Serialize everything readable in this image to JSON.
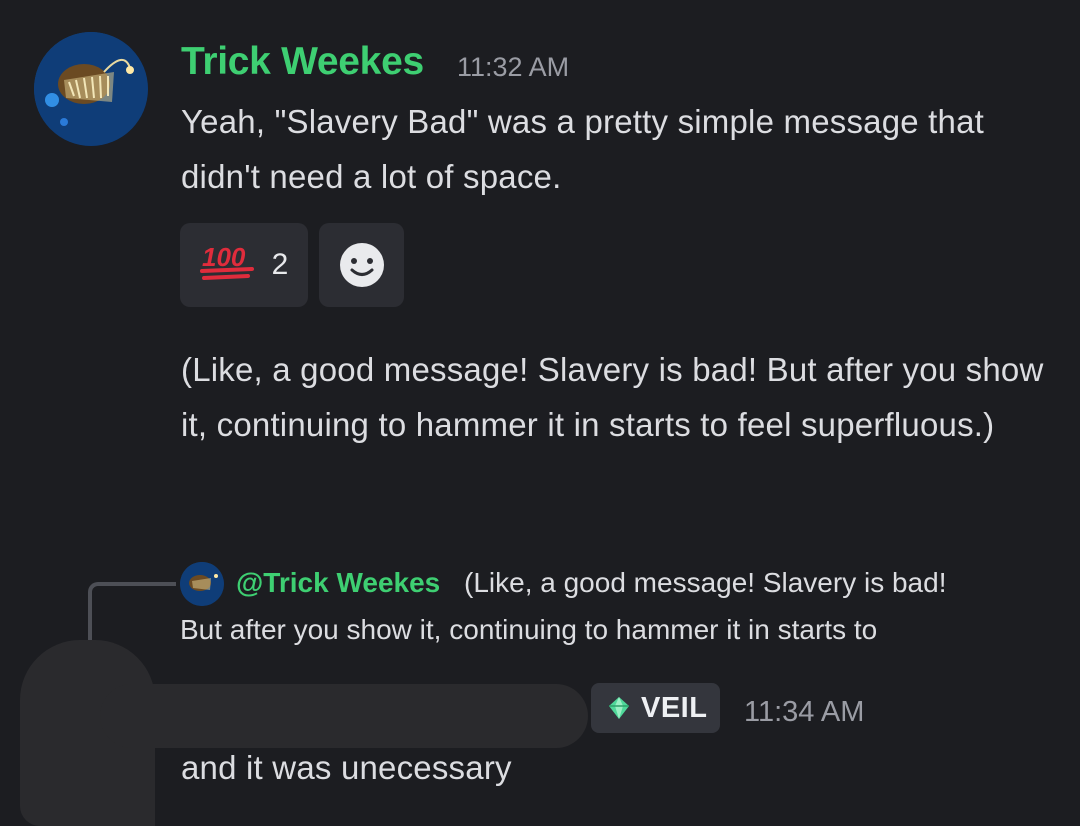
{
  "message1": {
    "author": "Trick Weekes",
    "timestamp": "11:32 AM",
    "text": "Yeah, \"Slavery Bad\" was a pretty simple message that didn't need a lot of space.",
    "reactions": [
      {
        "emoji": "💯",
        "count": "2"
      }
    ],
    "add_reaction_icon": "smiley-icon",
    "followup_text": "(Like, a good message! Slavery is bad! But after you show it, continuing to hammer it in starts to feel superfluous.)"
  },
  "reply": {
    "mention": "@Trick Weekes",
    "quoted_text_line1": "(Like, a good message! Slavery is bad!",
    "quoted_text_line2": "But after you show it, continuing to hammer it in starts to",
    "tag_label": "VEIL",
    "tag_icon": "green-gem-icon",
    "timestamp": "11:34 AM",
    "text": "and it was unecessary"
  },
  "colors": {
    "background": "#1c1d21",
    "username": "#3ecf72",
    "text": "#dcdde1",
    "muted": "#9a9ca4",
    "reaction_bg": "#2c2d33"
  }
}
